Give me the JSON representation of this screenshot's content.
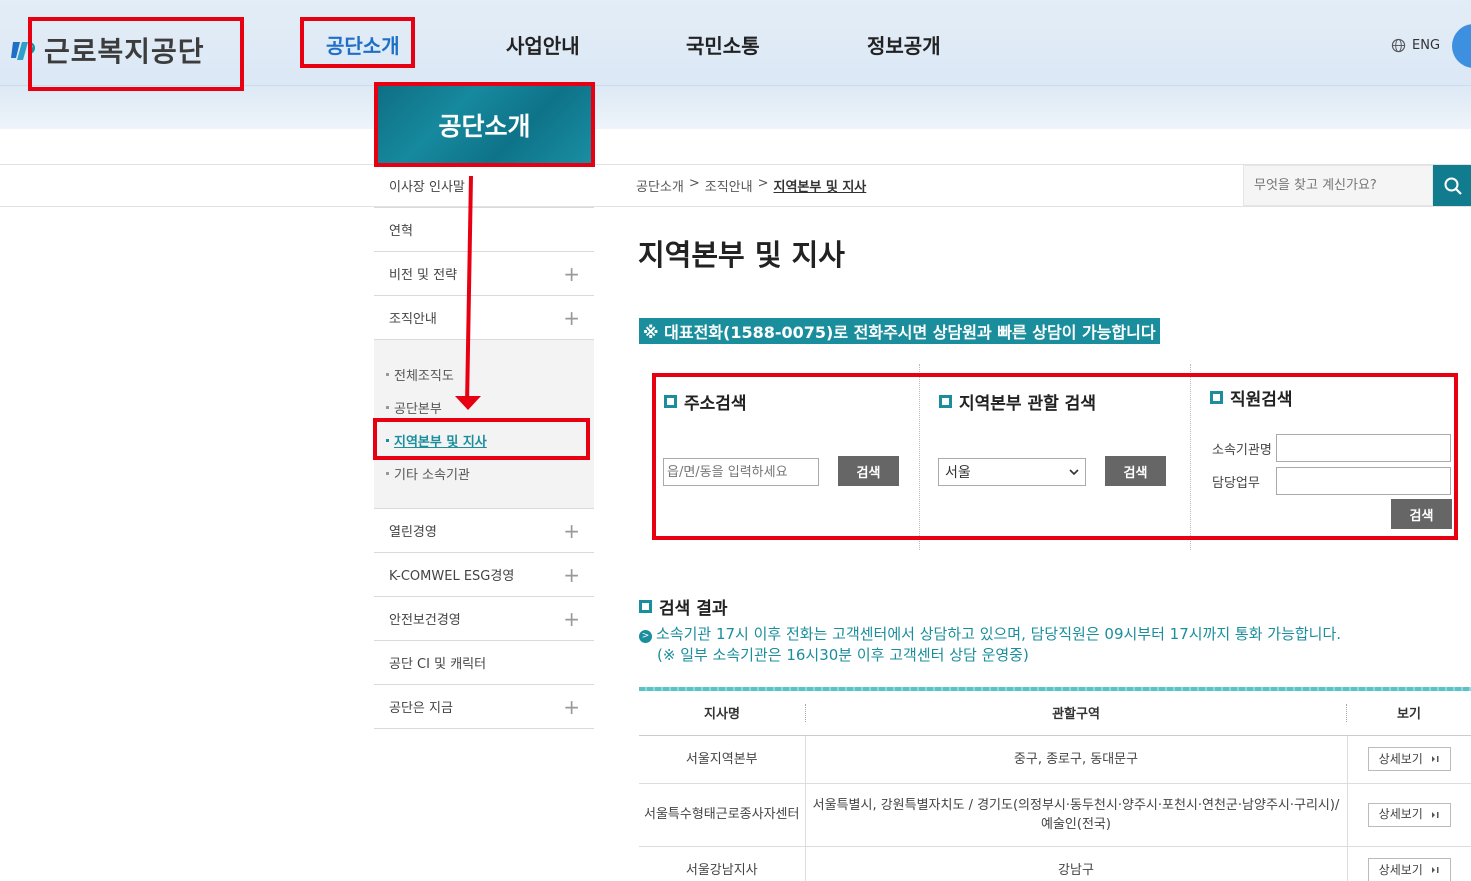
{
  "header": {
    "logo_text": "근로복지공단",
    "nav": [
      "공단소개",
      "사업안내",
      "국민소통",
      "정보공개"
    ],
    "lang": "ENG"
  },
  "lnb": {
    "title": "공단소개",
    "items_top": [
      {
        "label": "이사장 인사말",
        "expandable": false
      },
      {
        "label": "연혁",
        "expandable": false
      },
      {
        "label": "비전 및 전략",
        "expandable": true
      },
      {
        "label": "조직안내",
        "expandable": true
      }
    ],
    "sub_items": [
      "전체조직도",
      "공단본부",
      "지역본부 및 지사",
      "기타 소속기관"
    ],
    "items_bottom": [
      {
        "label": "열린경영",
        "expandable": true
      },
      {
        "label": "K-COMWEL ESG경영",
        "expandable": true
      },
      {
        "label": "안전보건경영",
        "expandable": true
      },
      {
        "label": "공단 CI 및 캐릭터",
        "expandable": false
      },
      {
        "label": "공단은 지금",
        "expandable": true
      }
    ],
    "plus": "+"
  },
  "breadcrumb": [
    "공단소개",
    ">",
    "조직안내",
    ">",
    "지역본부 및 지사"
  ],
  "search": {
    "placeholder": "무엇을 찾고 계신가요?"
  },
  "page_title": "지역본부 및 지사",
  "notice": "※ 대표전화(1588-0075)로 전화주시면 상담원과 빠른 상담이 가능합니다",
  "address_search": {
    "title": "주소검색",
    "placeholder": "읍/면/동을 입력하세요",
    "button": "검색"
  },
  "region_search": {
    "title": "지역본부 관할 검색",
    "selected": "서울",
    "button": "검색"
  },
  "staff_search": {
    "title": "직원검색",
    "org_label": "소속기관명",
    "duty_label": "담당업무",
    "button": "검색"
  },
  "results": {
    "title": "검색 결과",
    "msg_icon": ">",
    "msg1": "소속기관 17시 이후 전화는 고객센터에서 상담하고 있으며, 담당직원은 09시부터 17시까지 통화 가능합니다.",
    "msg2": "(※ 일부 소속기관은 16시30분 이후 고객센터 상담 운영중)",
    "columns": [
      "지사명",
      "관할구역",
      "보기"
    ],
    "rows": [
      {
        "name": "서울지역본부",
        "area": "중구, 종로구, 동대문구",
        "button": "상세보기"
      },
      {
        "name": "서울특수형태근로종사자센터",
        "area": "서울특별시, 강원특별자치도 / 경기도(의정부시·동두천시·양주시·포천시·연천군·남양주시·구리시)/예술인(전국)",
        "button": "상세보기"
      },
      {
        "name": "서울강남지사",
        "area": "강남구",
        "button": "상세보기"
      }
    ]
  },
  "colors": {
    "accent": "#1a8e9c",
    "annotation": "#e60012",
    "nav_active": "#1f6fc6"
  }
}
